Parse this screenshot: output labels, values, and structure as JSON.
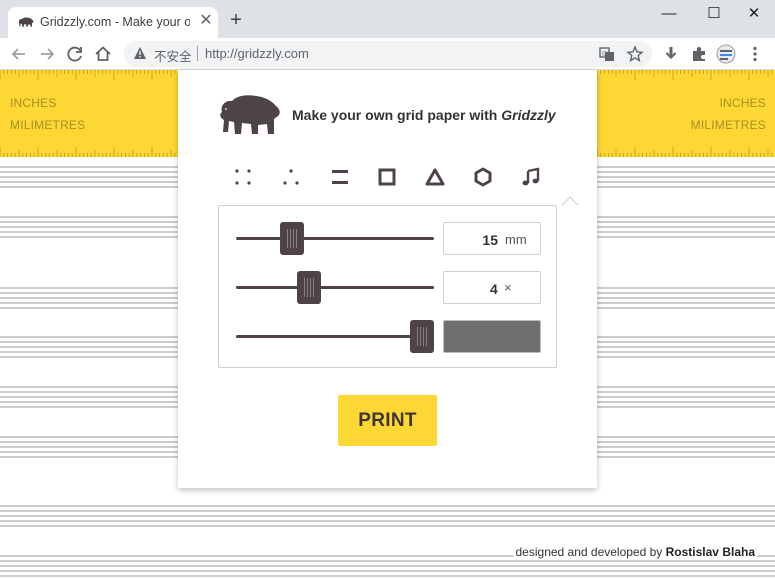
{
  "browser": {
    "tab_title": "Gridzzly.com - Make your own",
    "tab_close": "✕",
    "new_tab": "+",
    "security_label": "不安全",
    "url": "http://gridzzly.com",
    "window_minimize": "—",
    "window_maximize": "☐",
    "window_close": "✕"
  },
  "ruler": {
    "inches": "INCHES",
    "millimetres": "MILIMETRES"
  },
  "card": {
    "heading_prefix": "Make your own grid paper with ",
    "heading_brand": "Gridzzly",
    "paper_types": [
      {
        "name": "dots",
        "icon": "dot-grid-icon"
      },
      {
        "name": "triangular-dots",
        "icon": "triangle-dots-icon"
      },
      {
        "name": "lines",
        "icon": "lines-icon"
      },
      {
        "name": "squares",
        "icon": "square-icon"
      },
      {
        "name": "triangles",
        "icon": "triangle-icon"
      },
      {
        "name": "hexagons",
        "icon": "hexagon-icon"
      },
      {
        "name": "music",
        "icon": "music-note-icon",
        "selected": true
      }
    ],
    "controls": {
      "size": {
        "value": "15",
        "unit": "mm",
        "level": 0.25
      },
      "thickness": {
        "value": "4",
        "unit": "×",
        "level": 0.35
      },
      "color": {
        "swatch": "#6f6f6f",
        "level": 1.0
      }
    },
    "print_label": "PRINT"
  },
  "footer": {
    "credit_prefix": "designed and developed by ",
    "credit_author": "Rostislav Blaha"
  },
  "colors": {
    "accent": "#fdd835",
    "dark": "#4e4446"
  }
}
